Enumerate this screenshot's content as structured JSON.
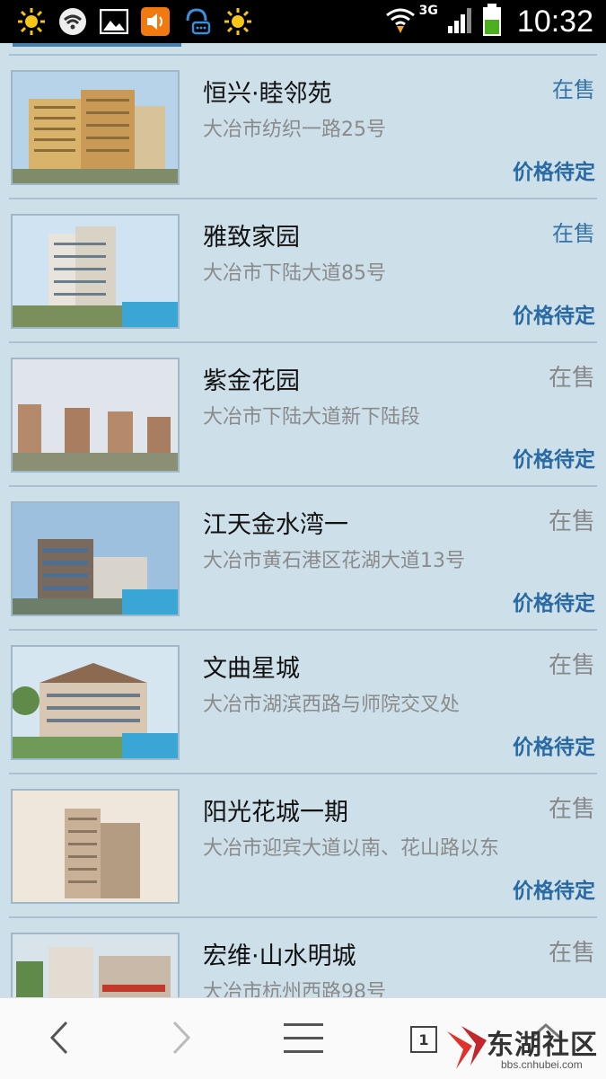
{
  "status_bar": {
    "time": "10:32",
    "network": "3G",
    "icons": [
      "sun-icon",
      "wifi-icon",
      "image-icon",
      "speaker-icon",
      "chat-icon",
      "sun-icon",
      "wifi-signal-icon",
      "cell-signal-icon",
      "battery-icon"
    ]
  },
  "listings": [
    {
      "name": "恒兴·睦邻苑",
      "address": "大冶市纺织一路25号",
      "status": "在售",
      "price": "价格待定"
    },
    {
      "name": "雅致家园",
      "address": "大冶市下陆大道85号",
      "status": "在售",
      "price": "价格待定"
    },
    {
      "name": "紫金花园",
      "address": "大冶市下陆大道新下陆段",
      "status": "在售",
      "price": "价格待定"
    },
    {
      "name": "江天金水湾一",
      "address": "大冶市黄石港区花湖大道13号",
      "status": "在售",
      "price": "价格待定"
    },
    {
      "name": "文曲星城",
      "address": "大冶市湖滨西路与师院交叉处",
      "status": "在售",
      "price": "价格待定"
    },
    {
      "name": "阳光花城一期",
      "address": "大冶市迎宾大道以南、花山路以东",
      "status": "在售",
      "price": "价格待定"
    },
    {
      "name": "宏维·山水明城",
      "address": "大冶市杭州西路98号",
      "status": "在售",
      "price": ""
    }
  ],
  "toolbar": {
    "tab_count": "1",
    "icons": [
      "back-icon",
      "forward-icon",
      "menu-icon",
      "tabs-icon",
      "home-icon"
    ]
  },
  "watermark": {
    "text": "东湖社区",
    "url": "bbs.cnhubei.com"
  },
  "colors": {
    "background": "#cde0ea",
    "status_blue": "#3572a8",
    "price_blue": "#2a6aa3"
  }
}
